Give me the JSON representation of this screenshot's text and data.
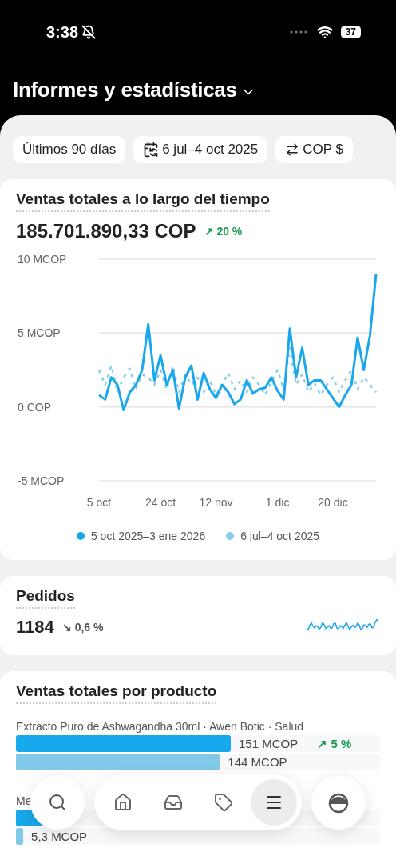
{
  "status_bar": {
    "time": "3:38",
    "battery": "37"
  },
  "header": {
    "title": "Informes y estadísticas"
  },
  "filters": [
    {
      "kind": "plain",
      "label": "Últimos 90 días"
    },
    {
      "kind": "calendar",
      "label": "6 jul–4 oct 2025"
    },
    {
      "kind": "currency",
      "label": "COP $"
    }
  ],
  "sales_card": {
    "title": "Ventas totales a lo largo del tiempo",
    "total": "185.701.890,33 COP",
    "arrow": "↗",
    "change": "20 %",
    "positive": true,
    "chart_data": {
      "type": "line",
      "ylim": [
        -5,
        10
      ],
      "yticks": [
        {
          "value": 10,
          "label": "10 MCOP"
        },
        {
          "value": 5,
          "label": "5 MCOP"
        },
        {
          "value": 0,
          "label": "0 COP"
        },
        {
          "value": -5,
          "label": "-5 MCOP"
        }
      ],
      "categories": [
        "5 oct",
        null,
        null,
        null,
        null,
        null,
        null,
        null,
        null,
        null,
        "24 oct",
        null,
        null,
        null,
        null,
        null,
        null,
        null,
        null,
        "12 nov",
        null,
        null,
        null,
        null,
        null,
        null,
        null,
        null,
        null,
        "1 dic",
        null,
        null,
        null,
        null,
        null,
        null,
        null,
        null,
        "20 dic",
        null,
        null,
        null,
        null,
        null,
        null,
        null
      ],
      "series": [
        {
          "name": "5 oct 2025–3 ene 2026",
          "color": "#1aa7ec",
          "line_style": "solid",
          "values": [
            0.8,
            0.5,
            2.0,
            1.5,
            -0.2,
            1.0,
            1.5,
            2.5,
            5.6,
            1.8,
            3.5,
            1.5,
            2.5,
            -0.1,
            2.0,
            2.8,
            0.5,
            2.3,
            1.2,
            0.6,
            1.5,
            1.0,
            0.2,
            0.5,
            1.8,
            0.9,
            1.2,
            1.3,
            2.0,
            1.1,
            0.5,
            5.3,
            2.0,
            4.0,
            1.5,
            1.8,
            1.8,
            1.2,
            0.6,
            0.0,
            0.8,
            1.5,
            4.7,
            2.5,
            4.8,
            9.0
          ]
        },
        {
          "name": "6 jul–4 oct 2025",
          "color": "#86cdec",
          "line_style": "dashed",
          "values": [
            2.5,
            1.5,
            2.8,
            1.0,
            2.0,
            2.6,
            1.2,
            2.2,
            2.0,
            1.5,
            2.5,
            1.2,
            2.8,
            1.0,
            2.2,
            1.5,
            2.0,
            1.0,
            1.8,
            0.8,
            1.5,
            2.3,
            1.2,
            1.8,
            1.0,
            2.0,
            1.5,
            0.8,
            1.7,
            2.5,
            1.2,
            4.0,
            1.5,
            2.2,
            1.0,
            1.6,
            0.8,
            1.5,
            2.0,
            1.0,
            1.8,
            2.5,
            1.2,
            2.0,
            1.5,
            1.0
          ]
        }
      ]
    }
  },
  "orders_card": {
    "title": "Pedidos",
    "value": "1184",
    "arrow": "↘",
    "change": "0,6 %",
    "positive": false
  },
  "products_card": {
    "title": "Ventas totales por producto",
    "products": [
      {
        "label": "Extracto Puro de Ashwagandha 30ml · Awen Botic · Salud",
        "bars": [
          {
            "kind": "current",
            "level": 0.59,
            "value": "151 MCOP",
            "arrow": "↗",
            "change": "5 %",
            "positive": true
          },
          {
            "kind": "previous",
            "level": 0.56,
            "value": "144 MCOP"
          }
        ]
      },
      {
        "label": "Me",
        "bars": [
          {
            "kind": "current",
            "level": 0.12
          },
          {
            "kind": "previous",
            "level": 0.02,
            "value": "5,3 MCOP"
          }
        ]
      }
    ]
  },
  "nav": {
    "items": [
      {
        "kind": "home",
        "selected": false
      },
      {
        "kind": "inbox",
        "selected": false
      },
      {
        "kind": "tag",
        "selected": false
      },
      {
        "kind": "menu",
        "selected": true
      }
    ]
  }
}
